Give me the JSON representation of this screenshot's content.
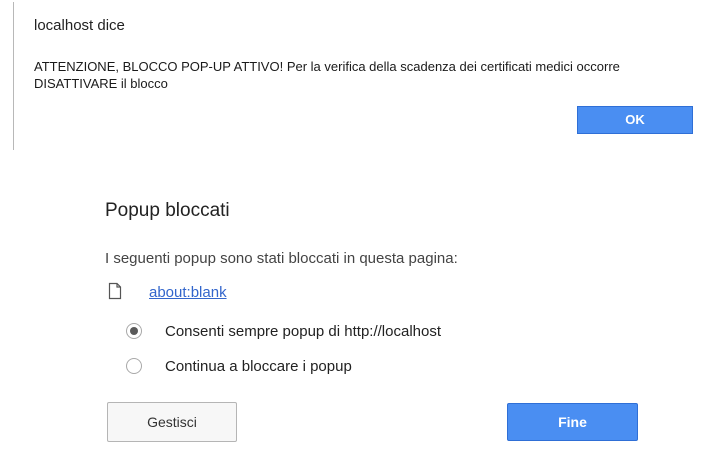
{
  "alert": {
    "title": "localhost dice",
    "message": "ATTENZIONE, BLOCCO POP-UP ATTIVO! Per la verifica della scadenza dei certificati medici occorre DISATTIVARE il blocco",
    "ok_label": "OK"
  },
  "popup_blocker": {
    "title": "Popup bloccati",
    "description": "I seguenti popup sono stati bloccati in questa pagina:",
    "blocked_items": [
      {
        "icon": "page-icon",
        "label": "about:blank"
      }
    ],
    "options": [
      {
        "label": "Consenti sempre popup di http://localhost",
        "selected": true
      },
      {
        "label": "Continua a bloccare i popup",
        "selected": false
      }
    ],
    "manage_label": "Gestisci",
    "done_label": "Fine"
  },
  "colors": {
    "primary_button": "#4a8ef2",
    "link": "#3366cc"
  }
}
